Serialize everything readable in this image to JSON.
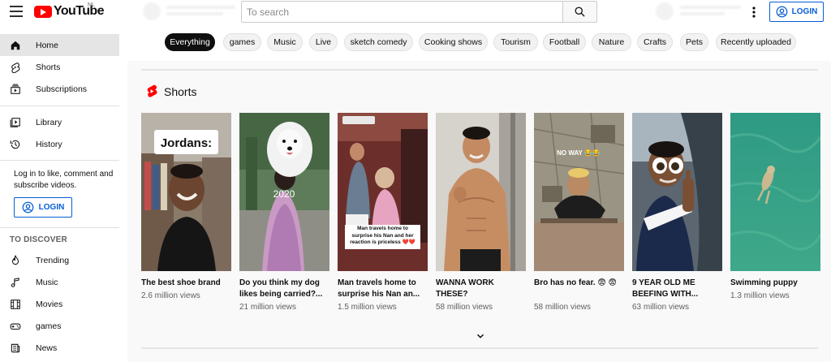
{
  "header": {
    "logo_text": "YouTube",
    "region": "NL",
    "search_placeholder": "To search",
    "login_label": "LOGIN"
  },
  "sidebar": {
    "items": [
      {
        "label": "Home",
        "icon": "home-icon",
        "active": true
      },
      {
        "label": "Shorts",
        "icon": "shorts-icon"
      },
      {
        "label": "Subscriptions",
        "icon": "subscriptions-icon"
      },
      {
        "label": "Library",
        "icon": "library-icon"
      },
      {
        "label": "History",
        "icon": "history-icon"
      }
    ],
    "login_message": "Log in to like, comment and subscribe videos.",
    "login_label": "LOGIN",
    "discover_heading": "TO DISCOVER",
    "discover_items": [
      {
        "label": "Trending",
        "icon": "trending-icon"
      },
      {
        "label": "Music",
        "icon": "music-icon"
      },
      {
        "label": "Movies",
        "icon": "movies-icon"
      },
      {
        "label": "games",
        "icon": "gaming-icon"
      },
      {
        "label": "News",
        "icon": "news-icon"
      }
    ]
  },
  "chips": [
    "Everything",
    "games",
    "Music",
    "Live",
    "sketch comedy",
    "Cooking shows",
    "Tourism",
    "Football",
    "Nature",
    "Crafts",
    "Pets",
    "Recently uploaded"
  ],
  "active_chip": "Everything",
  "shorts": {
    "title": "Shorts",
    "items": [
      {
        "title": "The best shoe brand",
        "views": "2.6 million views",
        "overlay": "Jordans:"
      },
      {
        "title": "Do you think my dog likes being carried?...",
        "views": "21 million views",
        "overlay": "2020"
      },
      {
        "title": "Man travels home to surprise his Nan an...",
        "views": "1.5 million views",
        "overlay": "Man travels home to surprise his Nan and her reaction is priceless ❤️❤️"
      },
      {
        "title": "WANNA WORK THESE?",
        "views": "58 million views",
        "overlay": ""
      },
      {
        "title": "Bro has no fear. 😨 😨",
        "views": "58 million views",
        "overlay": "NO WAY 😂😂"
      },
      {
        "title": "9 YEAR OLD ME BEEFING WITH...",
        "views": "63 million views",
        "overlay": ""
      },
      {
        "title": "Swimming puppy",
        "views": "1.3 million views",
        "overlay": ""
      }
    ]
  },
  "colors": {
    "brand_red": "#ff0000",
    "link_blue": "#065fd4"
  }
}
